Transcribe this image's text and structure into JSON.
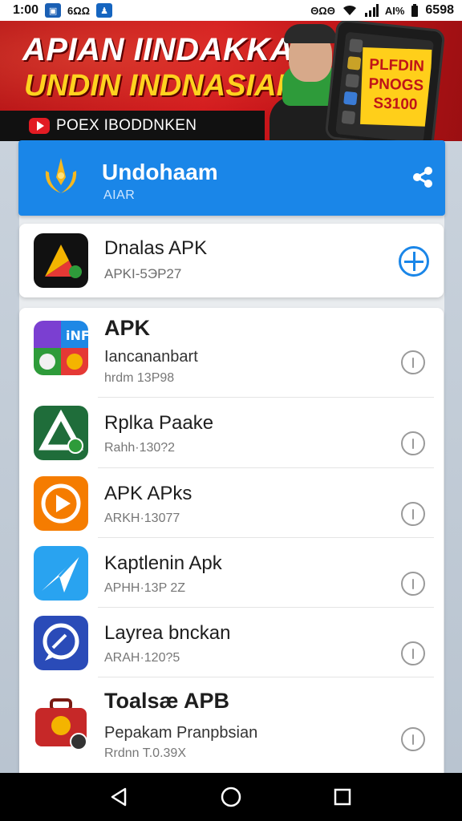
{
  "status_bar": {
    "time": "1:00",
    "carrier": "6ΩΩ",
    "right_small": "ΘΩΘ",
    "signal_text": "AI%",
    "battery": "6598"
  },
  "banner": {
    "line1": "APIAN IINDAKKAIN",
    "line2": "UNDIN INDNASIAI",
    "channel": "POEX IBODDNKEN",
    "phone_price": [
      "PLFDIN",
      "PNOGS",
      "S3100"
    ]
  },
  "header": {
    "title": "Undohaam",
    "subtitle": "AIAR"
  },
  "featured": {
    "name": "Dnalas APK",
    "meta": "APKI-5ЭP27"
  },
  "list": {
    "items": [
      {
        "name": "APK",
        "desc": "Iancananbart",
        "meta": "hrdm 13P98"
      },
      {
        "name": "Rplka Paake",
        "desc": "",
        "meta": "Rahh·130?2"
      },
      {
        "name": "APK APks",
        "desc": "",
        "meta": "ARKH·13077"
      },
      {
        "name": "Kaptlenin Apk",
        "desc": "",
        "meta": "APHH·13P 2Z"
      },
      {
        "name": "Layrea bnckan",
        "desc": "",
        "meta": "ARAH·120?5"
      },
      {
        "name": "Toalsæ APB",
        "desc": "Pepakam Pranpbsian",
        "meta": "Rrdnn T.0.39X"
      }
    ]
  },
  "colors": {
    "accent": "#1a86e8",
    "banner_red": "#c8161b",
    "banner_yellow": "#ffd21f"
  },
  "icons": {
    "share": "share-icon",
    "add": "add-circle-icon",
    "info": "info-icon",
    "back": "back-triangle-icon",
    "home": "home-circle-icon",
    "recents": "recents-square-icon"
  }
}
